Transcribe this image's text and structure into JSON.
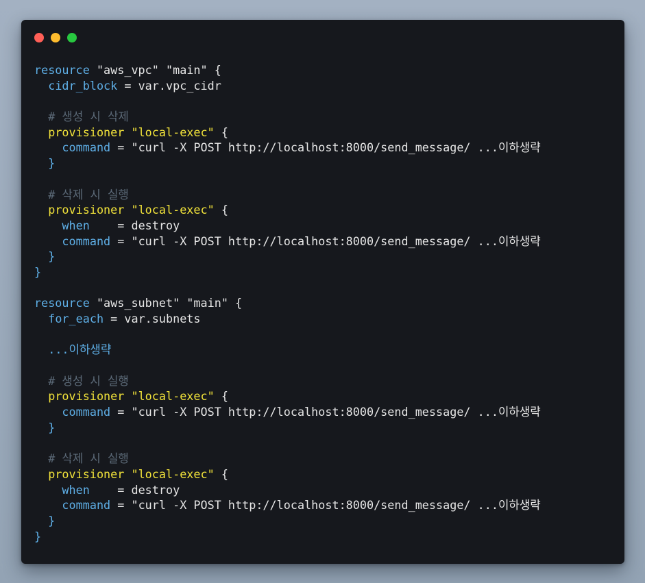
{
  "window": {
    "controls": {
      "close_color": "#ff5f57",
      "minimize_color": "#febc2e",
      "zoom_color": "#28c840"
    }
  },
  "colors": {
    "keyword": "#5fb0e8",
    "provisioner": "#f2e33a",
    "comment": "#5c6a78",
    "text": "#e6e6e6",
    "background": "#16181d"
  },
  "code": {
    "block1": {
      "keyword": "resource",
      "type": "\"aws_vpc\"",
      "name": "\"main\"",
      "open": "{",
      "attr1_key": "cidr_block",
      "attr1_value": "= var.vpc_cidr",
      "comment1": "# 생성 시 삭제",
      "prov1_keyword": "provisioner",
      "prov1_type": "\"local-exec\"",
      "prov1_open": "{",
      "prov1_cmd_key": "command",
      "prov1_cmd_value": "= \"curl -X POST http://localhost:8000/send_message/ ...이하생략",
      "prov1_close": "}",
      "comment2": "# 삭제 시 실행",
      "prov2_keyword": "provisioner",
      "prov2_type": "\"local-exec\"",
      "prov2_open": "{",
      "prov2_when_key": "when",
      "prov2_when_value": "    = destroy",
      "prov2_cmd_key": "command",
      "prov2_cmd_value": "= \"curl -X POST http://localhost:8000/send_message/ ...이하생략",
      "prov2_close": "}",
      "close": "}"
    },
    "block2": {
      "keyword": "resource",
      "type": "\"aws_subnet\"",
      "name": "\"main\"",
      "open": "{",
      "attr1_key": "for_each",
      "attr1_value": "= var.subnets",
      "ellipsis": "...이하생략",
      "comment1": "# 생성 시 실행",
      "prov1_keyword": "provisioner",
      "prov1_type": "\"local-exec\"",
      "prov1_open": "{",
      "prov1_cmd_key": "command",
      "prov1_cmd_value": "= \"curl -X POST http://localhost:8000/send_message/ ...이하생략",
      "prov1_close": "}",
      "comment2": "# 삭제 시 실행",
      "prov2_keyword": "provisioner",
      "prov2_type": "\"local-exec\"",
      "prov2_open": "{",
      "prov2_when_key": "when",
      "prov2_when_value": "    = destroy",
      "prov2_cmd_key": "command",
      "prov2_cmd_value": "= \"curl -X POST http://localhost:8000/send_message/ ...이하생략",
      "prov2_close": "}",
      "close": "}"
    }
  }
}
